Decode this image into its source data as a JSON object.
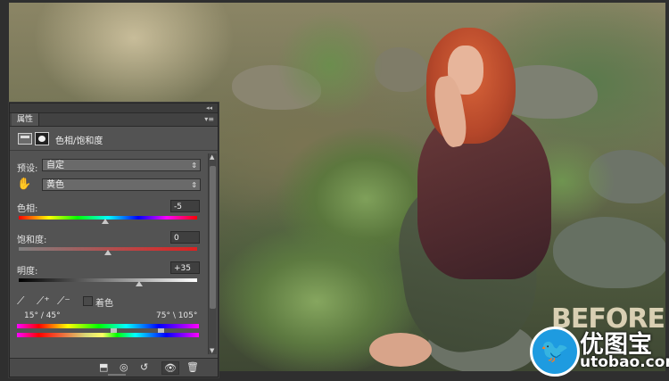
{
  "panel": {
    "tab_label": "属性",
    "title": "色相/饱和度",
    "preset_label": "预设:",
    "preset_value": "自定",
    "channel_value": "黄色",
    "hue_label": "色相:",
    "hue_value": "-5",
    "hue_level": -5,
    "saturation_label": "饱和度:",
    "saturation_value": "0",
    "saturation_level": 0,
    "lightness_label": "明度:",
    "lightness_value": "+35",
    "lightness_level": 35,
    "colorize_label": "着色",
    "range_left": "15° / 45°",
    "range_right": "75° \\ 105°"
  },
  "watermark": {
    "before_text": "BEFORE",
    "site_cn": "优图宝",
    "site_url": "utobao.com"
  },
  "icons": [
    "collapse-double-arrow-icon",
    "panel-menu-icon",
    "adjustment-layer-icon",
    "layer-mask-icon",
    "targeted-adjust-hand-icon",
    "eyedropper-icon",
    "eyedropper-plus-icon",
    "eyedropper-minus-icon",
    "clip-to-layer-icon",
    "view-previous-icon",
    "reset-icon",
    "visibility-eye-icon",
    "trash-icon"
  ]
}
